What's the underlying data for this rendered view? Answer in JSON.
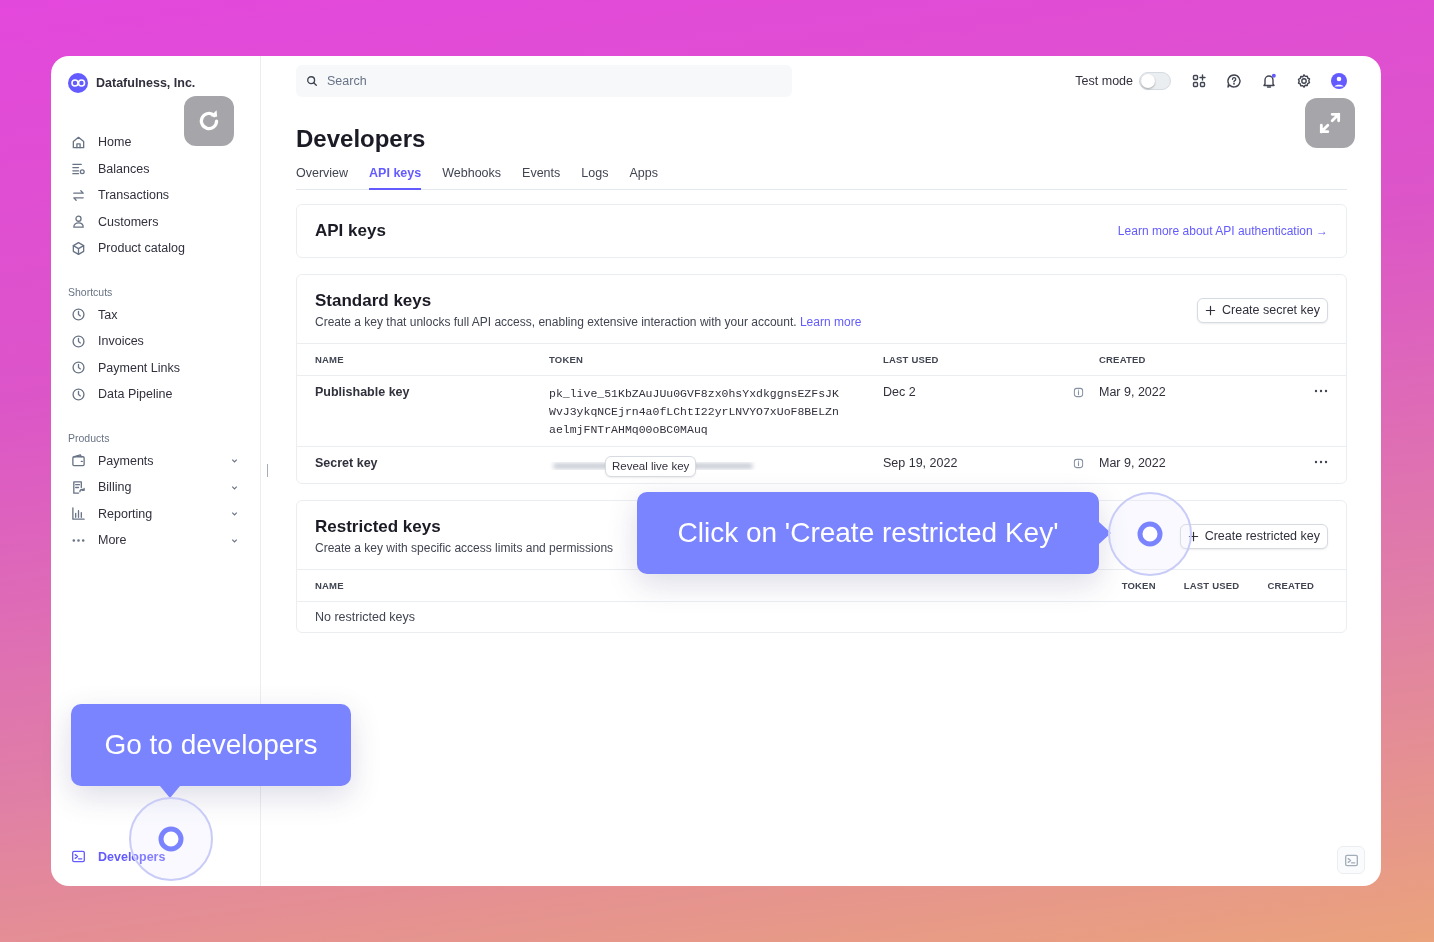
{
  "sidebar": {
    "account": "Datafulness, Inc.",
    "nav": [
      {
        "label": "Home",
        "kind": "home",
        "selected": false
      },
      {
        "label": "Balances",
        "kind": "balances",
        "selected": false
      },
      {
        "label": "Transactions",
        "kind": "transactions",
        "selected": false
      },
      {
        "label": "Customers",
        "kind": "customers",
        "selected": false
      },
      {
        "label": "Product catalog",
        "kind": "catalog",
        "selected": false
      }
    ],
    "sections": [
      {
        "title": "Shortcuts",
        "items": [
          {
            "label": "Tax",
            "kind": "clock",
            "selected": false
          },
          {
            "label": "Invoices",
            "kind": "clock",
            "selected": false
          },
          {
            "label": "Payment Links",
            "kind": "clock",
            "selected": false
          },
          {
            "label": "Data Pipeline",
            "kind": "clock",
            "selected": false
          }
        ]
      },
      {
        "title": "Products",
        "items": [
          {
            "label": "Payments",
            "kind": "payments",
            "selected": false,
            "expanded": false
          },
          {
            "label": "Billing",
            "kind": "billing",
            "selected": false,
            "expanded": false
          },
          {
            "label": "Reporting",
            "kind": "reporting",
            "selected": false,
            "expanded": false
          },
          {
            "label": "More",
            "kind": "more",
            "selected": false,
            "expanded": false
          }
        ]
      }
    ],
    "footer": [
      {
        "label": "Developers",
        "kind": "terminal",
        "selected": true
      }
    ]
  },
  "topbar": {
    "search": {
      "placeholder": "Search"
    },
    "test_mode": {
      "label": "Test mode",
      "on": false
    }
  },
  "page": {
    "title": "Developers",
    "tabs": [
      {
        "label": "Overview",
        "selected": false
      },
      {
        "label": "API keys",
        "selected": true
      },
      {
        "label": "Webhooks",
        "selected": false
      },
      {
        "label": "Events",
        "selected": false
      },
      {
        "label": "Logs",
        "selected": false
      },
      {
        "label": "Apps",
        "selected": false
      }
    ]
  },
  "api_keys": {
    "title": "API keys",
    "link": "Learn more about API authentication →"
  },
  "standard_keys": {
    "title": "Standard keys",
    "description": "Create a key that unlocks full API access, enabling extensive interaction with your account.",
    "link": "Learn more",
    "button": "Create secret key",
    "columns": [
      "NAME",
      "TOKEN",
      "LAST USED",
      "CREATED"
    ],
    "rows": [
      {
        "name": "Publishable key",
        "kind": "visible",
        "token": [
          "pk_live_51KbZAuJUu0GVF8zx0hsYxdkggnsEZFsJK",
          "WvJ3ykqNCEjrn4a0fLChtI22yrLNVYO7xUoF8BELZn",
          "aelmjFNTrAHMq00oBC0MAuq"
        ],
        "last_used": "Dec 2",
        "created": "Mar 9, 2022"
      },
      {
        "name": "Secret key",
        "kind": "hidden",
        "reveal": "Reveal live key",
        "last_used": "Sep 19, 2022",
        "created": "Mar 9, 2022"
      }
    ]
  },
  "restricted_keys": {
    "title": "Restricted keys",
    "description": "Create a key with specific access limits and permissions",
    "button": "Create restricted key",
    "columns": [
      "NAME",
      "TOKEN",
      "LAST USED",
      "CREATED"
    ],
    "empty": "No restricted keys"
  },
  "guides": [
    {
      "text": "Go to developers"
    },
    {
      "text": "Click on 'Create restricted Key'"
    }
  ]
}
